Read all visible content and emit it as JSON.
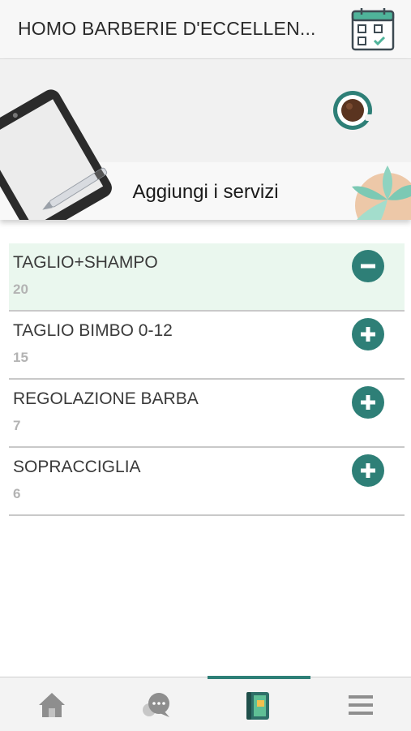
{
  "header": {
    "title": "HOMO BARBERIE D'ECCELLEN...",
    "calendar_icon": "calendar-check-icon"
  },
  "banner": {
    "title": "Aggiungi i servizi",
    "illustrations": [
      "tablet-icon",
      "coffee-cup-icon",
      "plant-icon"
    ]
  },
  "services": [
    {
      "name": "TAGLIO+SHAMPO",
      "price": "20",
      "selected": true,
      "action_icon": "minus-icon"
    },
    {
      "name": "TAGLIO BIMBO 0-12",
      "price": "15",
      "selected": false,
      "action_icon": "plus-icon"
    },
    {
      "name": "REGOLAZIONE BARBA",
      "price": "7",
      "selected": false,
      "action_icon": "plus-icon"
    },
    {
      "name": "SOPRACCIGLIA",
      "price": "6",
      "selected": false,
      "action_icon": "plus-icon"
    }
  ],
  "bottom_nav": {
    "items": [
      "home-icon",
      "chat-icon",
      "booking-book-icon",
      "menu-icon"
    ],
    "active_index": 2
  },
  "colors": {
    "accent": "#2e7f77",
    "selected_row": "#eaf7ee",
    "price_text": "#b3b3b3"
  }
}
